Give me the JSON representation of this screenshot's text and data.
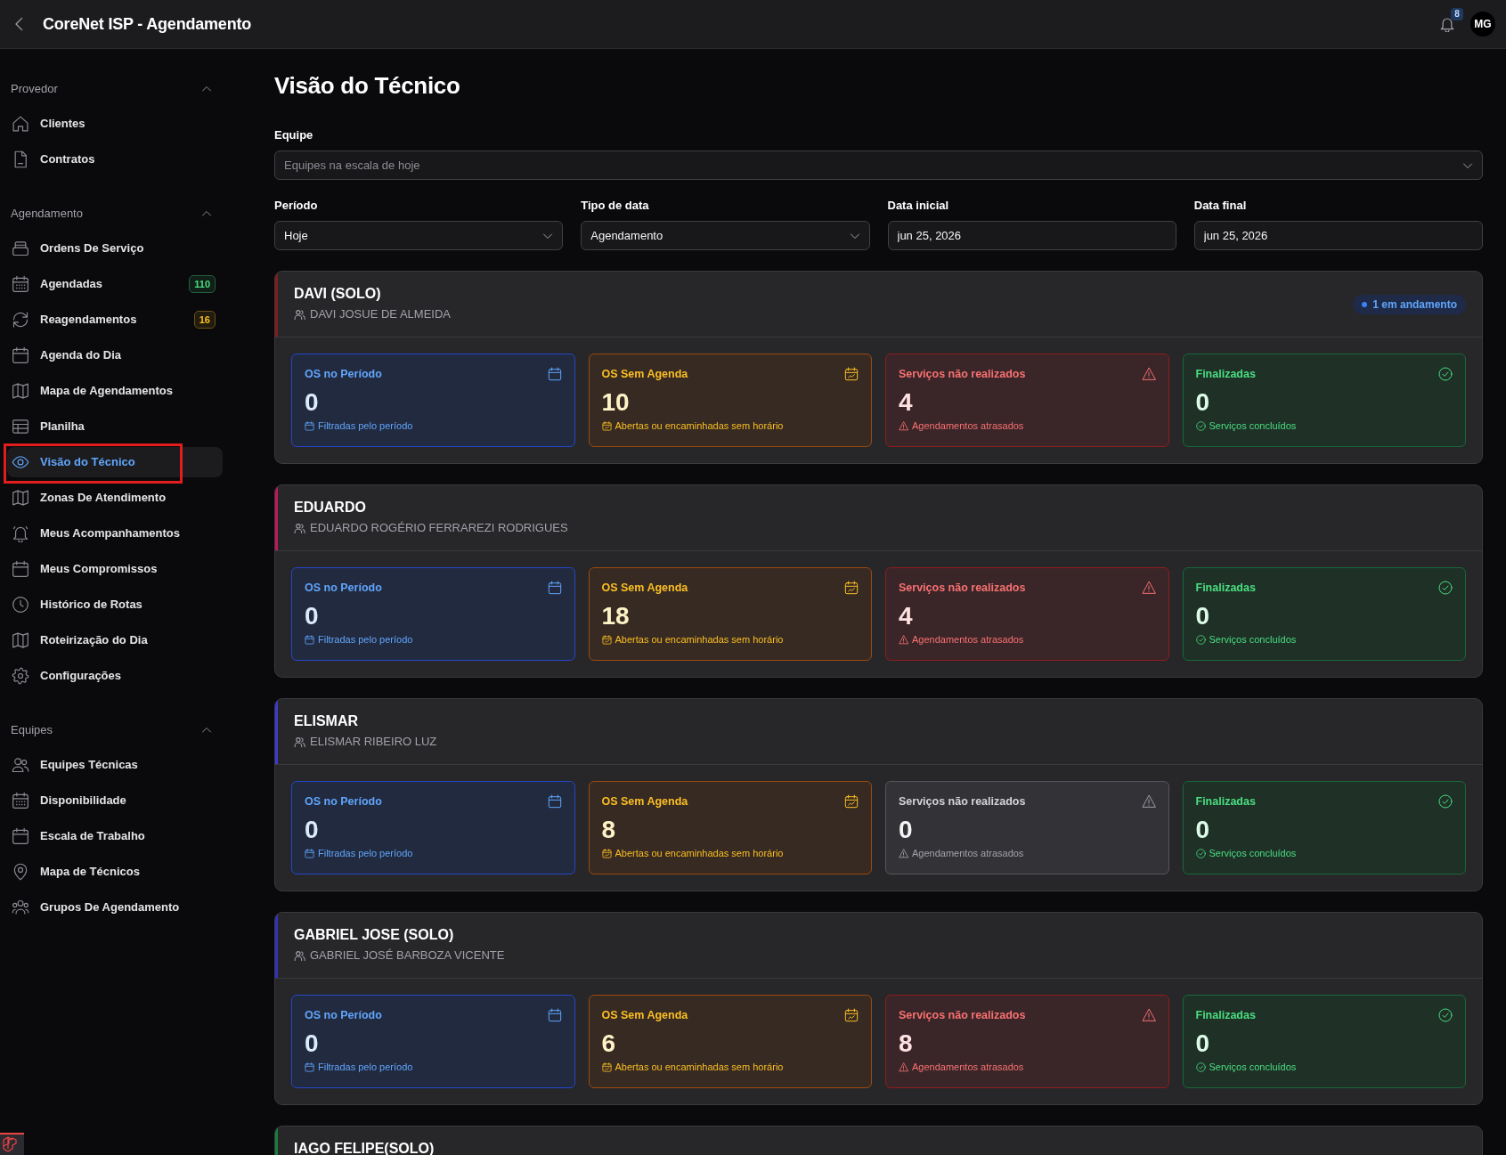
{
  "app_bar": {
    "title": "CoreNet ISP - Agendamento",
    "notification_count": "8",
    "avatar_initials": "MG"
  },
  "sidebar": {
    "sections": [
      {
        "title": "Provedor",
        "expanded": true,
        "items": [
          {
            "label": "Clientes",
            "selected": false,
            "highlighted": false
          },
          {
            "label": "Contratos",
            "selected": false,
            "highlighted": false
          }
        ]
      },
      {
        "title": "Agendamento",
        "expanded": true,
        "items": [
          {
            "label": "Ordens De Serviço",
            "selected": false,
            "highlighted": false
          },
          {
            "label": "Agendadas",
            "selected": false,
            "highlighted": false,
            "badge": {
              "text": "110",
              "color": "#4ade80"
            }
          },
          {
            "label": "Reagendamentos",
            "selected": false,
            "highlighted": false,
            "badge": {
              "text": "16",
              "color": "#fbbf24"
            }
          },
          {
            "label": "Agenda do Dia",
            "selected": false,
            "highlighted": false
          },
          {
            "label": "Mapa de Agendamentos",
            "selected": false,
            "highlighted": false
          },
          {
            "label": "Planilha",
            "selected": false,
            "highlighted": false
          },
          {
            "label": "Visão do Técnico",
            "selected": true,
            "highlighted": true
          },
          {
            "label": "Zonas De Atendimento",
            "selected": false,
            "highlighted": false
          },
          {
            "label": "Meus Acompanhamentos",
            "selected": false,
            "highlighted": false
          },
          {
            "label": "Meus Compromissos",
            "selected": false,
            "highlighted": false
          },
          {
            "label": "Histórico de Rotas",
            "selected": false,
            "highlighted": false
          },
          {
            "label": "Roteirização do Dia",
            "selected": false,
            "highlighted": false
          },
          {
            "label": "Configurações",
            "selected": false,
            "highlighted": false
          }
        ]
      },
      {
        "title": "Equipes",
        "expanded": true,
        "items": [
          {
            "label": "Equipes Técnicas",
            "selected": false,
            "highlighted": false
          },
          {
            "label": "Disponibilidade",
            "selected": false,
            "highlighted": false
          },
          {
            "label": "Escala de Trabalho",
            "selected": false,
            "highlighted": false
          },
          {
            "label": "Mapa de Técnicos",
            "selected": false,
            "highlighted": false
          },
          {
            "label": "Grupos De Agendamento",
            "selected": false,
            "highlighted": false
          }
        ]
      }
    ]
  },
  "page": {
    "title": "Visão do Técnico"
  },
  "team_filter": {
    "kind": "select",
    "label": "Equipe",
    "placeholder": "Equipes na escala de hoje"
  },
  "filters": [
    {
      "kind": "select",
      "label": "Período",
      "value": "Hoje"
    },
    {
      "kind": "select",
      "label": "Tipo de data",
      "value": "Agendamento"
    },
    {
      "kind": "date",
      "label": "Data inicial",
      "value": "jun 25, 2026"
    },
    {
      "kind": "date",
      "label": "Data final",
      "value": "jun 25, 2026"
    }
  ],
  "teams": [
    {
      "name": "DAVI (SOLO)",
      "members": "DAVI JOSUE DE ALMEIDA",
      "color": "#7f1d1d",
      "status_badge": "1 em andamento",
      "stats": [
        {
          "kind": "period",
          "title": "OS no Período",
          "value": "0",
          "note": "Filtradas pelo período",
          "muted": false
        },
        {
          "kind": "unscheduled",
          "title": "OS Sem Agenda",
          "value": "10",
          "note": "Abertas ou encaminhadas sem horário",
          "muted": false
        },
        {
          "kind": "not_done",
          "title": "Serviços não realizados",
          "value": "4",
          "note": "Agendamentos atrasados",
          "muted": false
        },
        {
          "kind": "finished",
          "title": "Finalizadas",
          "value": "0",
          "note": "Serviços concluídos",
          "muted": false
        }
      ]
    },
    {
      "name": "EDUARDO",
      "members": "EDUARDO ROGÉRIO FERRAREZI RODRIGUES",
      "color": "#be185d",
      "stats": [
        {
          "kind": "period",
          "title": "OS no Período",
          "value": "0",
          "note": "Filtradas pelo período",
          "muted": false
        },
        {
          "kind": "unscheduled",
          "title": "OS Sem Agenda",
          "value": "18",
          "note": "Abertas ou encaminhadas sem horário",
          "muted": false
        },
        {
          "kind": "not_done",
          "title": "Serviços não realizados",
          "value": "4",
          "note": "Agendamentos atrasados",
          "muted": false
        },
        {
          "kind": "finished",
          "title": "Finalizadas",
          "value": "0",
          "note": "Serviços concluídos",
          "muted": false
        }
      ]
    },
    {
      "name": "ELISMAR",
      "members": "ELISMAR RIBEIRO LUZ",
      "color": "#3b3bd4",
      "stats": [
        {
          "kind": "period",
          "title": "OS no Período",
          "value": "0",
          "note": "Filtradas pelo período",
          "muted": false
        },
        {
          "kind": "unscheduled",
          "title": "OS Sem Agenda",
          "value": "8",
          "note": "Abertas ou encaminhadas sem horário",
          "muted": false
        },
        {
          "kind": "not_done",
          "title": "Serviços não realizados",
          "value": "0",
          "note": "Agendamentos atrasados",
          "muted": true
        },
        {
          "kind": "finished",
          "title": "Finalizadas",
          "value": "0",
          "note": "Serviços concluídos",
          "muted": false
        }
      ]
    },
    {
      "name": "GABRIEL JOSE (SOLO)",
      "members": "GABRIEL JOSÉ BARBOZA VICENTE",
      "color": "#3232c0",
      "stats": [
        {
          "kind": "period",
          "title": "OS no Período",
          "value": "0",
          "note": "Filtradas pelo período",
          "muted": false
        },
        {
          "kind": "unscheduled",
          "title": "OS Sem Agenda",
          "value": "6",
          "note": "Abertas ou encaminhadas sem horário",
          "muted": false
        },
        {
          "kind": "not_done",
          "title": "Serviços não realizados",
          "value": "8",
          "note": "Agendamentos atrasados",
          "muted": false
        },
        {
          "kind": "finished",
          "title": "Finalizadas",
          "value": "0",
          "note": "Serviços concluídos",
          "muted": false
        }
      ]
    },
    {
      "name": "IAGO FELIPE(SOLO)",
      "color": "#15803d"
    }
  ]
}
